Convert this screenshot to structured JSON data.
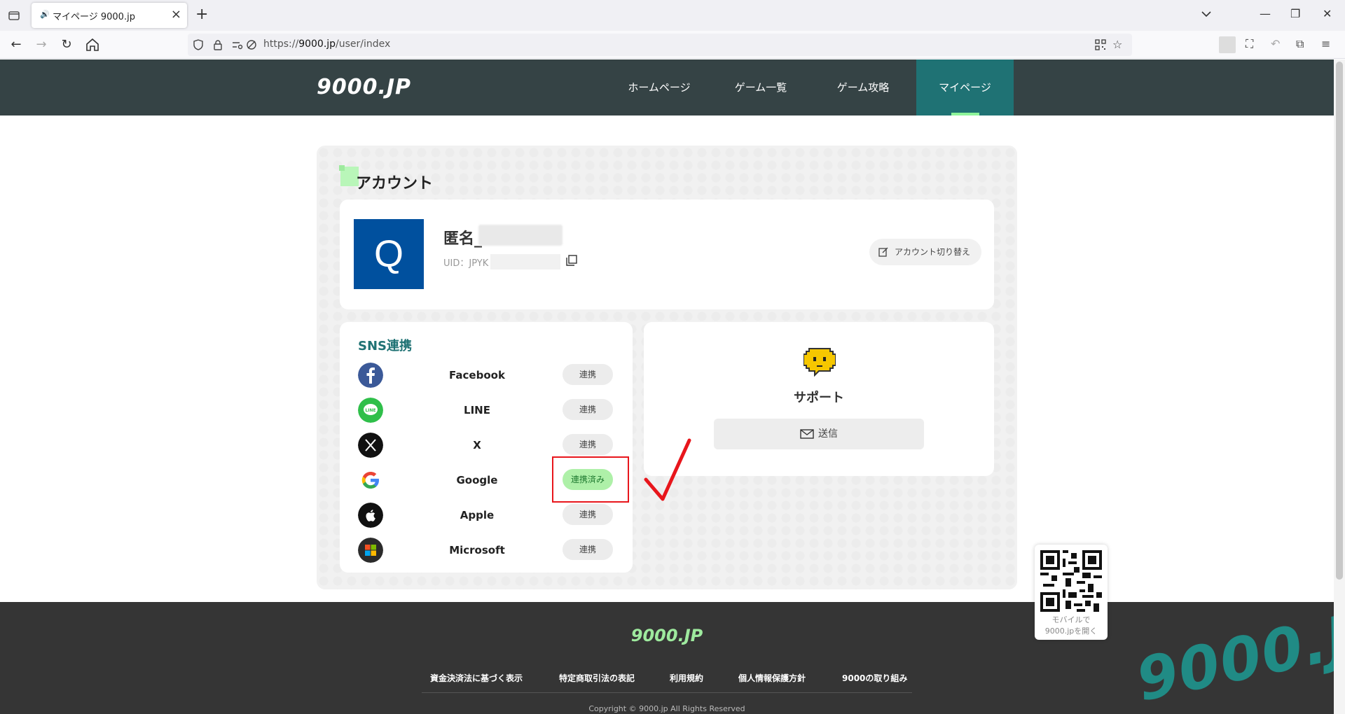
{
  "browser": {
    "tab_title": "マイページ 9000.jp",
    "url_prefix": "https://",
    "url_host": "9000.jp",
    "url_path": "/user/index"
  },
  "site": {
    "logo": "9000.JP",
    "nav": [
      "ホームページ",
      "ゲーム一覧",
      "ゲーム攻略",
      "マイページ"
    ],
    "active_nav": "マイページ"
  },
  "account": {
    "section_title": "アカウント",
    "avatar_letter": "Q",
    "name_prefix": "匿名_",
    "uid_label": "UID：JPYK",
    "switch_label": "アカウント切り替え"
  },
  "sns": {
    "title": "SNS連携",
    "items": [
      {
        "name": "Facebook",
        "button": "連携",
        "linked": false,
        "icon": "facebook-icon"
      },
      {
        "name": "LINE",
        "button": "連携",
        "linked": false,
        "icon": "line-icon"
      },
      {
        "name": "X",
        "button": "連携",
        "linked": false,
        "icon": "x-icon"
      },
      {
        "name": "Google",
        "button": "連携済み",
        "linked": true,
        "icon": "google-icon"
      },
      {
        "name": "Apple",
        "button": "連携",
        "linked": false,
        "icon": "apple-icon"
      },
      {
        "name": "Microsoft",
        "button": "連携",
        "linked": false,
        "icon": "microsoft-icon"
      }
    ]
  },
  "support": {
    "label": "サポート",
    "send": "送信"
  },
  "footer": {
    "logo": "9000.JP",
    "links": [
      "資金決済法に基づく表示",
      "特定商取引法の表記",
      "利用規約",
      "個人情報保護方針",
      "9000の取り組み"
    ],
    "copyright": "Copyright © 9000.jp All Rights Reserved"
  },
  "qr": {
    "line1": "モバイルで",
    "line2": "9000.jpを開く"
  },
  "watermark": "9000.JP",
  "colors": {
    "header_bg": "#354345",
    "active_nav": "#1f7274",
    "accent_green": "#9eea9e",
    "avatar_bg": "#00509e",
    "annotation_red": "#e8161c"
  }
}
